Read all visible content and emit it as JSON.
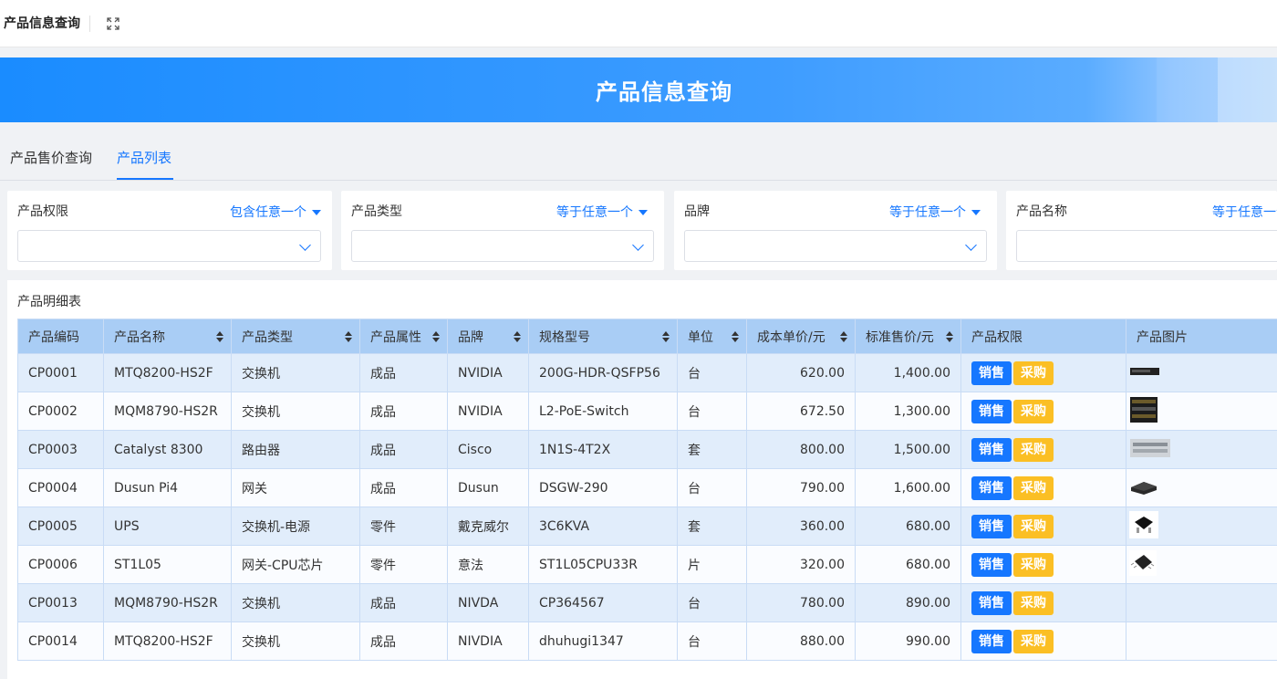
{
  "topbar": {
    "title": "产品信息查询"
  },
  "banner": {
    "title": "产品信息查询"
  },
  "tabs": [
    {
      "label": "产品售价查询",
      "active": false
    },
    {
      "label": "产品列表",
      "active": true
    }
  ],
  "filters": [
    {
      "label": "产品权限",
      "operator": "包含任意一个",
      "value": ""
    },
    {
      "label": "产品类型",
      "operator": "等于任意一个",
      "value": ""
    },
    {
      "label": "品牌",
      "operator": "等于任意一个",
      "value": ""
    },
    {
      "label": "产品名称",
      "operator": "等于任意一个",
      "value": ""
    }
  ],
  "table": {
    "title": "产品明细表",
    "columns": [
      "产品编码",
      "产品名称",
      "产品类型",
      "产品属性",
      "品牌",
      "规格型号",
      "单位",
      "成本单价/元",
      "标准售价/元",
      "产品权限",
      "产品图片"
    ],
    "action_labels": {
      "sale": "销售",
      "buy": "采购"
    },
    "rows": [
      {
        "code": "CP0001",
        "name": "MTQ8200-HS2F",
        "type": "交换机",
        "attr": "成品",
        "brand": "NVIDIA",
        "model": "200G-HDR-QSFP56",
        "unit": "台",
        "cost": "620.00",
        "price": "1,400.00",
        "image": "switch-1u-icon"
      },
      {
        "code": "CP0002",
        "name": "MQM8790-HS2R",
        "type": "交换机",
        "attr": "成品",
        "brand": "NVIDIA",
        "model": "L2-PoE-Switch",
        "unit": "台",
        "cost": "672.50",
        "price": "1,300.00",
        "image": "switch-rack-icon"
      },
      {
        "code": "CP0003",
        "name": "Catalyst 8300",
        "type": "路由器",
        "attr": "成品",
        "brand": "Cisco",
        "model": "1N1S-4T2X",
        "unit": "套",
        "cost": "800.00",
        "price": "1,500.00",
        "image": "router-icon"
      },
      {
        "code": "CP0004",
        "name": "Dusun Pi4",
        "type": "网关",
        "attr": "成品",
        "brand": "Dusun",
        "model": "DSGW-290",
        "unit": "台",
        "cost": "790.00",
        "price": "1,600.00",
        "image": "gateway-icon"
      },
      {
        "code": "CP0005",
        "name": "UPS",
        "type": "交换机-电源",
        "attr": "零件",
        "brand": "戴克威尔",
        "model": "3C6KVA",
        "unit": "套",
        "cost": "360.00",
        "price": "680.00",
        "image": "power-chip-icon"
      },
      {
        "code": "CP0006",
        "name": "ST1L05",
        "type": "网关-CPU芯片",
        "attr": "零件",
        "brand": "意法",
        "model": "ST1L05CPU33R",
        "unit": "片",
        "cost": "320.00",
        "price": "680.00",
        "image": "cpu-chip-icon"
      },
      {
        "code": "CP0013",
        "name": "MQM8790-HS2R",
        "type": "交换机",
        "attr": "成品",
        "brand": "NIVDA",
        "model": "CP364567",
        "unit": "台",
        "cost": "780.00",
        "price": "890.00",
        "image": ""
      },
      {
        "code": "CP0014",
        "name": "MTQ8200-HS2F",
        "type": "交换机",
        "attr": "成品",
        "brand": "NIVDIA",
        "model": "dhuhugi1347",
        "unit": "台",
        "cost": "880.00",
        "price": "990.00",
        "image": ""
      }
    ]
  },
  "colors": {
    "accent": "#1677ff",
    "sale": "#1677ff",
    "buy": "#fbbf24",
    "header": "#a9cdf5",
    "row_odd": "#e1edfb"
  }
}
